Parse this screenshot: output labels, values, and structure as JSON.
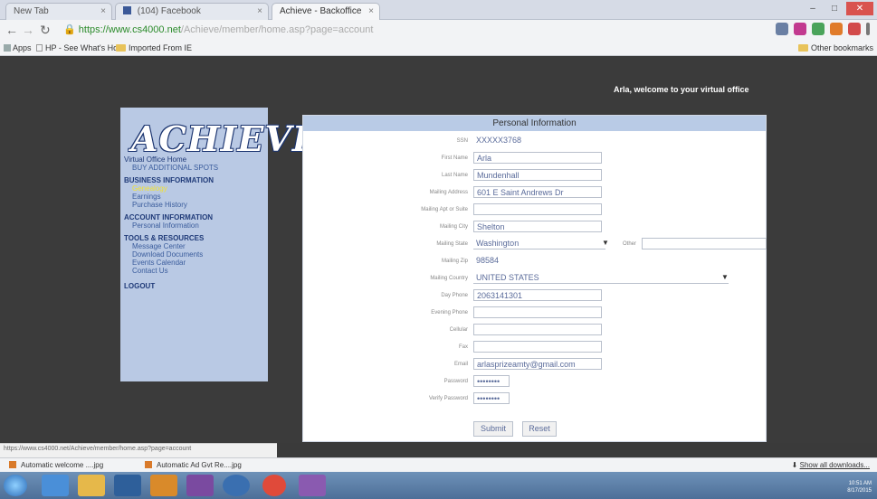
{
  "browser": {
    "tabs": [
      "New Tab",
      "(104) Facebook",
      "Achieve - Backoffice"
    ],
    "url_secure": "https://www.cs4000.net",
    "url_path": "/Achieve/member/home.asp?page=account",
    "bookmarks": [
      "Apps",
      "HP - See What's Hot",
      "Imported From IE"
    ],
    "other_bookmarks": "Other bookmarks",
    "window_buttons": [
      "–",
      "□",
      "✕"
    ]
  },
  "page": {
    "welcome": "Arla, welcome to your virtual office",
    "logo": "ACHIEVE",
    "menu": {
      "virtual_office_home": "Virtual Office Home",
      "buy_spots": "BUY ADDITIONAL SPOTS",
      "business_info": {
        "heading": "BUSINESS INFORMATION",
        "items": [
          "Genealogy",
          "Earnings",
          "Purchase History"
        ]
      },
      "account_info": {
        "heading": "ACCOUNT INFORMATION",
        "items": [
          "Personal Information"
        ]
      },
      "tools": {
        "heading": "TOOLS & RESOURCES",
        "items": [
          "Message Center",
          "Download Documents",
          "Events Calendar",
          "Contact Us"
        ]
      },
      "logout": "LOGOUT"
    },
    "form": {
      "title": "Personal Information",
      "fields": [
        {
          "label": "SSN",
          "value": "XXXXX3768"
        },
        {
          "label": "First Name",
          "value": "Arla"
        },
        {
          "label": "Last Name",
          "value": "Mundenhall"
        },
        {
          "label": "Mailing Address",
          "value": "601 E Saint Andrews Dr"
        },
        {
          "label": "Mailing Apt or Suite",
          "value": ""
        },
        {
          "label": "Mailing City",
          "value": "Shelton"
        },
        {
          "label": "Mailing State",
          "value": "Washington"
        },
        {
          "label": "Mailing Zip",
          "value": "98584"
        },
        {
          "label": "Mailing Country",
          "value": "UNITED STATES"
        },
        {
          "label": "Day Phone",
          "value": "2063141301"
        },
        {
          "label": "Evening Phone",
          "value": ""
        },
        {
          "label": "Cellular",
          "value": ""
        },
        {
          "label": "Fax",
          "value": ""
        },
        {
          "label": "Email",
          "value": "arlasprizeamty@gmail.com"
        },
        {
          "label": "Password",
          "value": "••••••••"
        },
        {
          "label": "Verify Password",
          "value": "••••••••"
        }
      ],
      "other_label": "Other",
      "submit": "Submit",
      "reset": "Reset"
    }
  },
  "status_bar": "https://www.cs4000.net/Achieve/member/home.asp?page=account",
  "downloads": {
    "items": [
      "Automatic welcome ....jpg",
      "Automatic Ad Gvt Re....jpg"
    ],
    "show_all": "Show all downloads..."
  },
  "taskbar": {
    "time": "10:51 AM",
    "date": "8/17/2015"
  },
  "colors": {
    "page_bg": "#3b3b3b",
    "sidebar": "#b9c9e4",
    "form_header": "#b9cbe6",
    "menu_highlight": "#f3e232"
  }
}
